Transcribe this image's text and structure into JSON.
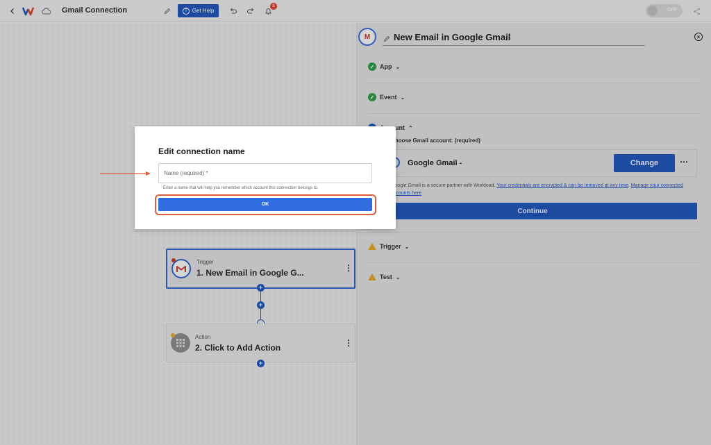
{
  "header": {
    "title": "Gmail Connection",
    "help_label": "Get Help",
    "notification_count": "6",
    "toggle_label": "OFF"
  },
  "panel": {
    "icon_letter": "M",
    "title": "New Email in Google Gmail",
    "sections": {
      "app": "App",
      "event": "Event",
      "account": "Account",
      "trigger": "Trigger",
      "test": "Test"
    },
    "account_label": "Choose Gmail account: (required)",
    "account_name": "Google Gmail -",
    "change_label": "Change",
    "more_label": "⋯",
    "note_text": "Google Gmail is a secure partner with Workload.",
    "note_link1": "Your credentials are encrypted & can be removed at any time",
    "note_link2": "Manage your connected accounts here",
    "continue_label": "Continue"
  },
  "flow": {
    "trigger": {
      "sub": "Trigger",
      "main": "1. New Email in Google G..."
    },
    "action": {
      "sub": "Action",
      "main": "2. Click to Add Action"
    }
  },
  "modal": {
    "title": "Edit connection name",
    "input_placeholder": "Name (required) *",
    "input_value": "",
    "help": "Enter a name that will help you remember which account this connection belongs to.",
    "ok_label": "OK"
  },
  "colors": {
    "primary": "#2156b8",
    "ok_button": "#2f6de0",
    "highlight": "#de5a3c",
    "success": "#2e9a48",
    "warning": "#e3a227"
  }
}
